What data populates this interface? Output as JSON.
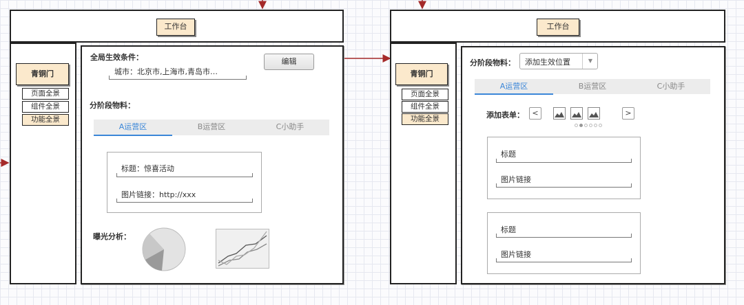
{
  "left_screen": {
    "header": {
      "title": "工作台"
    },
    "brand": "青铜门",
    "menu": [
      {
        "label": "页面全景",
        "active": false
      },
      {
        "label": "组件全景",
        "active": false
      },
      {
        "label": "功能全景",
        "active": true
      }
    ],
    "global_conditions": {
      "label": "全局生效条件：",
      "city_value": "城市：北京市,上海市,青岛市…",
      "edit_button": "编辑"
    },
    "staged_material": {
      "label": "分阶段物料：",
      "tabs": [
        "A运营区",
        "B运营区",
        "C小助手"
      ],
      "active_tab": 0,
      "title_field": "标题：惊喜活动",
      "image_link_field": "图片链接：http://xxx"
    },
    "exposure": {
      "label": "曝光分析："
    }
  },
  "right_screen": {
    "header": {
      "title": "工作台"
    },
    "brand": "青铜门",
    "menu": [
      {
        "label": "页面全景",
        "active": false
      },
      {
        "label": "组件全景",
        "active": false
      },
      {
        "label": "功能全景",
        "active": true
      }
    ],
    "staged_material": {
      "label": "分阶段物料：",
      "select_value": "添加生效位置",
      "tabs": [
        "A运营区",
        "B运营区",
        "C小助手"
      ],
      "active_tab": 0
    },
    "add_form": {
      "label": "添加表单：",
      "prev": "<",
      "next": ">",
      "forms": [
        {
          "title": "标题",
          "image_link": "图片链接"
        },
        {
          "title": "标题",
          "image_link": "图片链接"
        }
      ]
    }
  },
  "colors": {
    "arrow": "#a52a2a",
    "accent_tab": "#3a86d8",
    "tag_fill": "#fbe9cc"
  }
}
